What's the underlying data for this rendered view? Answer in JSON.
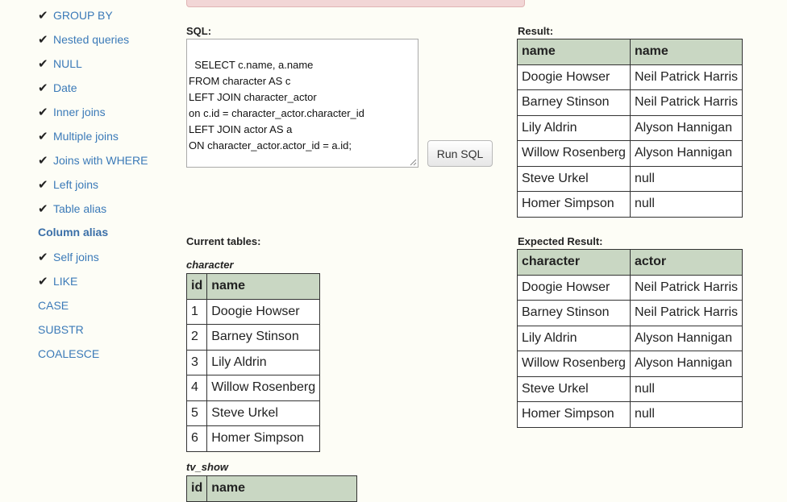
{
  "sidebar": {
    "items": [
      {
        "label": "GROUP BY",
        "done": true,
        "active": false
      },
      {
        "label": "Nested queries",
        "done": true,
        "active": false
      },
      {
        "label": "NULL",
        "done": true,
        "active": false
      },
      {
        "label": "Date",
        "done": true,
        "active": false
      },
      {
        "label": "Inner joins",
        "done": true,
        "active": false
      },
      {
        "label": "Multiple joins",
        "done": true,
        "active": false
      },
      {
        "label": "Joins with WHERE",
        "done": true,
        "active": false
      },
      {
        "label": "Left joins",
        "done": true,
        "active": false
      },
      {
        "label": "Table alias",
        "done": true,
        "active": false
      },
      {
        "label": "Column alias",
        "done": false,
        "active": true
      },
      {
        "label": "Self joins",
        "done": true,
        "active": false
      },
      {
        "label": "LIKE",
        "done": true,
        "active": false
      },
      {
        "label": "CASE",
        "done": false,
        "active": false
      },
      {
        "label": "SUBSTR",
        "done": false,
        "active": false
      },
      {
        "label": "COALESCE",
        "done": false,
        "active": false
      }
    ],
    "check_glyph": "✔"
  },
  "editor": {
    "label": "SQL:",
    "query": "SELECT c.name, a.name\nFROM character AS c\nLEFT JOIN character_actor\non c.id = character_actor.character_id\nLEFT JOIN actor AS a\nON character_actor.actor_id = a.id;",
    "run_label": "Run SQL"
  },
  "result": {
    "label": "Result:",
    "headers": [
      "name",
      "name"
    ],
    "rows": [
      [
        "Doogie Howser",
        "Neil Patrick Harris"
      ],
      [
        "Barney Stinson",
        "Neil Patrick Harris"
      ],
      [
        "Lily Aldrin",
        "Alyson Hannigan"
      ],
      [
        "Willow Rosenberg",
        "Alyson Hannigan"
      ],
      [
        "Steve Urkel",
        "null"
      ],
      [
        "Homer Simpson",
        "null"
      ]
    ]
  },
  "expected": {
    "label": "Expected Result:",
    "headers": [
      "character",
      "actor"
    ],
    "rows": [
      [
        "Doogie Howser",
        "Neil Patrick Harris"
      ],
      [
        "Barney Stinson",
        "Neil Patrick Harris"
      ],
      [
        "Lily Aldrin",
        "Alyson Hannigan"
      ],
      [
        "Willow Rosenberg",
        "Alyson Hannigan"
      ],
      [
        "Steve Urkel",
        "null"
      ],
      [
        "Homer Simpson",
        "null"
      ]
    ]
  },
  "current_tables": {
    "label": "Current tables:",
    "character": {
      "name": "character",
      "headers": [
        "id",
        "name"
      ],
      "rows": [
        [
          "1",
          "Doogie Howser"
        ],
        [
          "2",
          "Barney Stinson"
        ],
        [
          "3",
          "Lily Aldrin"
        ],
        [
          "4",
          "Willow Rosenberg"
        ],
        [
          "5",
          "Steve Urkel"
        ],
        [
          "6",
          "Homer Simpson"
        ]
      ]
    },
    "tv_show": {
      "name": "tv_show",
      "headers": [
        "id",
        "name"
      ]
    }
  },
  "colors": {
    "link": "#3b7ab8",
    "header_bg": "#c9d7c3",
    "alert_bg": "#f2d6d6",
    "page_bg": "#fdfdf6"
  }
}
